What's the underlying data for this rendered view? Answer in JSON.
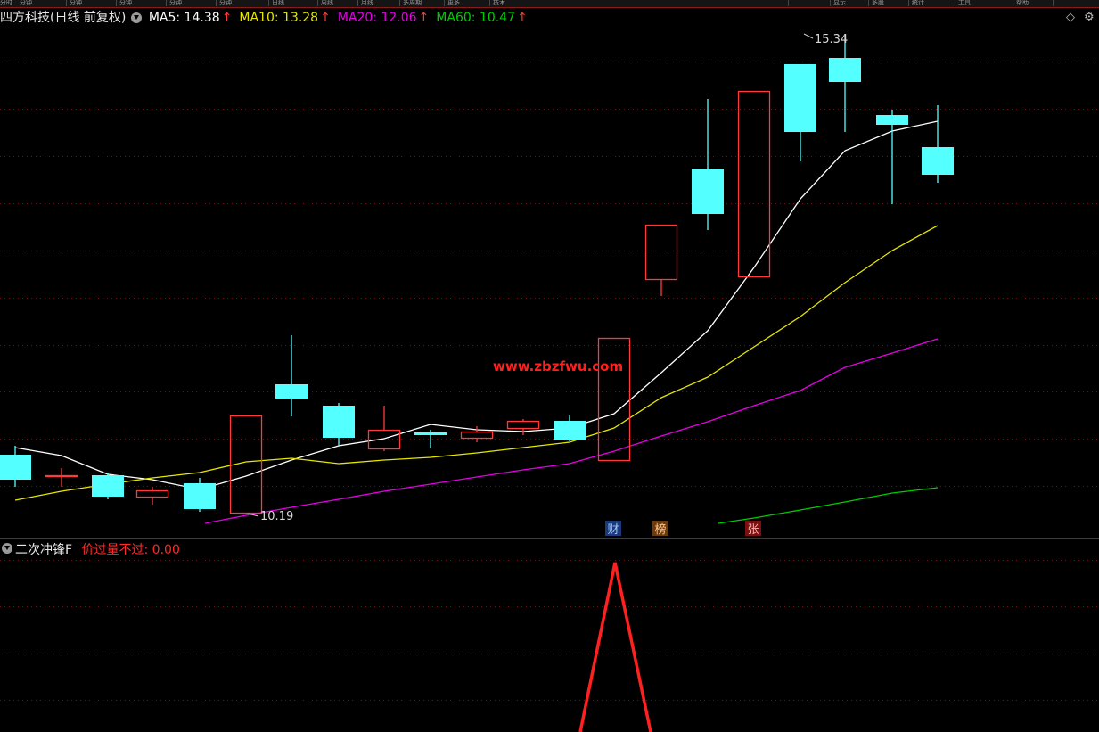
{
  "toolbar": {
    "buttons": [
      "分时",
      "分钟",
      "分钟",
      "分钟",
      "分钟",
      "分钟",
      "日线",
      "周线",
      "月线",
      "多周期",
      "更多",
      "技术",
      "显示",
      "多股",
      "统计",
      "工具",
      "帮助"
    ]
  },
  "main_chart": {
    "stock_name": "四方科技",
    "period_label": "(日线 前复权)",
    "ma": [
      {
        "label": "MA5: 14.38",
        "color": "#ffffff"
      },
      {
        "label": "MA10: 13.28",
        "color": "#e6e600"
      },
      {
        "label": "MA20: 12.06",
        "color": "#e600e6"
      },
      {
        "label": "MA60: 10.47",
        "color": "#00cc00"
      }
    ],
    "arrow_glyph": "↑",
    "max_label": "15.34",
    "min_label": "10.19",
    "watermark": "www.zbzfwu.com",
    "markers": [
      {
        "text": "财",
        "bg": "#1a3a7a",
        "color": "#9fc4ff"
      },
      {
        "text": "榜",
        "bg": "#6a3a10",
        "color": "#ffc68a"
      },
      {
        "text": "张",
        "bg": "#7a1010",
        "color": "#ffb0b0"
      }
    ],
    "up_color": "#ff3a3a",
    "down_color": "#54ffff"
  },
  "indicator": {
    "name": "二次冲锋F",
    "series_label": "价过量不过: 0.00",
    "line_color": "#ff2020"
  },
  "right_icons": [
    "diamond-icon",
    "settings-icon"
  ]
}
